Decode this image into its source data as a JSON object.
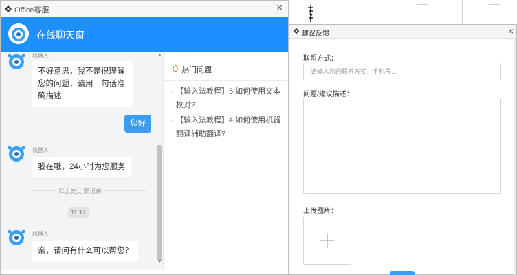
{
  "chat_window": {
    "title": "Office客服",
    "close_glyph": "×",
    "header_title": "在线聊天窗",
    "messages": {
      "bot_name": "机器人",
      "bot_msg_1": "不好意思，我不是很理解您的问题，请用一句话准确描述",
      "user_msg_1": "您好",
      "bot_msg_2": "我在哦，24小时为您服务",
      "history_label": "以上是历史记录",
      "time_label": "11:17",
      "bot_msg_3": "亲，请问有什么可以帮您？"
    },
    "hot_panel": {
      "title": "热门问题",
      "items": [
        "【输入法教程】5.如何使用文本校对?",
        "【输入法教程】4.如何使用机器翻译辅助翻译?"
      ]
    }
  },
  "feedback_window": {
    "title": "建议反馈",
    "close_glyph": "×",
    "contact_label": "联系方式：",
    "contact_placeholder": "请输入您的联系方式，手机号...",
    "description_label": "问题/建议描述：",
    "upload_label": "上传图片：",
    "upload_glyph": "+"
  },
  "colors": {
    "header_blue": "#1e8fff",
    "user_bubble": "#3c9cf2",
    "chat_bg": "#f2f4f6"
  }
}
